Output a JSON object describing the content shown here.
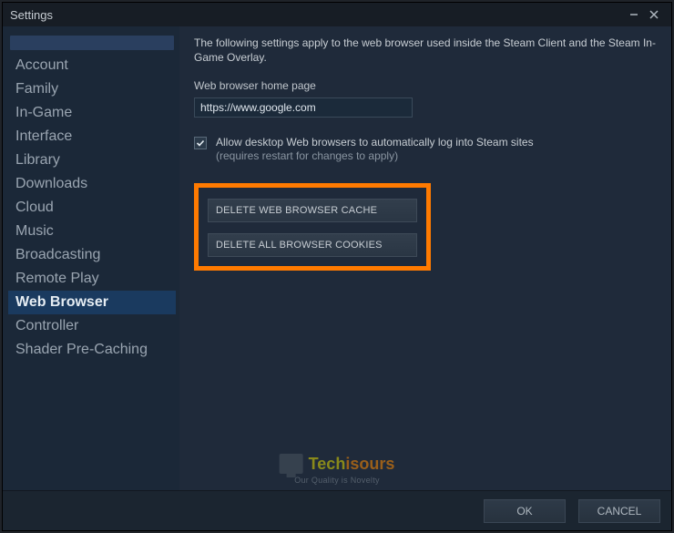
{
  "window": {
    "title": "Settings"
  },
  "sidebar": {
    "items": [
      {
        "label": "Account"
      },
      {
        "label": "Family"
      },
      {
        "label": "In-Game"
      },
      {
        "label": "Interface"
      },
      {
        "label": "Library"
      },
      {
        "label": "Downloads"
      },
      {
        "label": "Cloud"
      },
      {
        "label": "Music"
      },
      {
        "label": "Broadcasting"
      },
      {
        "label": "Remote Play"
      },
      {
        "label": "Web Browser",
        "selected": true
      },
      {
        "label": "Controller"
      },
      {
        "label": "Shader Pre-Caching"
      }
    ]
  },
  "content": {
    "description": "The following settings apply to the web browser used inside the Steam Client and the Steam In-Game Overlay.",
    "home_page_label": "Web browser home page",
    "home_page_value": "https://www.google.com",
    "checkbox_checked": true,
    "checkbox_label": "Allow desktop Web browsers to automatically log into Steam sites",
    "checkbox_sub": "(requires restart for changes to apply)",
    "delete_cache_btn": "DELETE WEB BROWSER CACHE",
    "delete_cookies_btn": "DELETE ALL BROWSER COOKIES"
  },
  "footer": {
    "ok": "OK",
    "cancel": "CANCEL"
  },
  "watermark": {
    "brand1": "Tech",
    "brand2": "isours",
    "tagline": "Our Quality is Novelty"
  }
}
